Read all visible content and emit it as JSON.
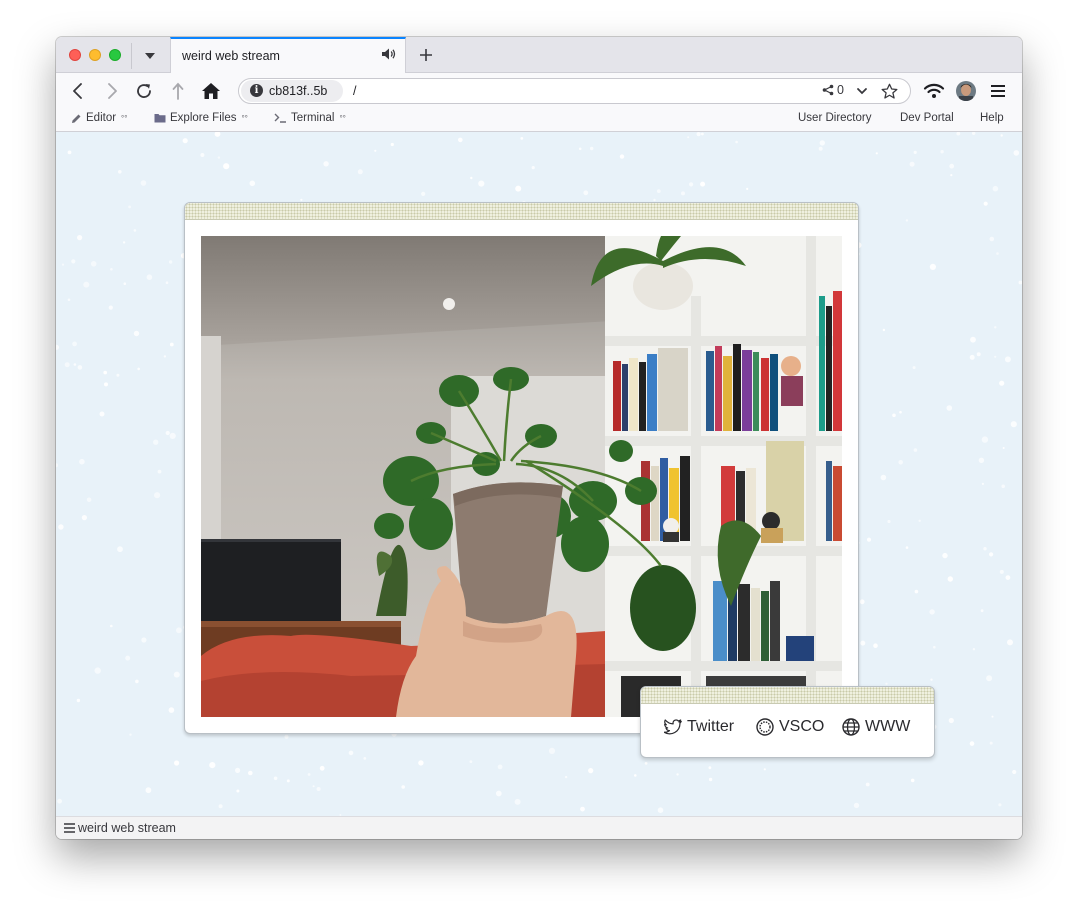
{
  "browser": {
    "tab": {
      "title": "weird web stream"
    },
    "url": {
      "host": "cb813f..5b",
      "path": "/",
      "share_count": "0"
    },
    "bookmarks_left": [
      {
        "label": "Editor",
        "suffix": "°°",
        "icon": "pencil-icon"
      },
      {
        "label": "Explore Files",
        "suffix": "°°",
        "icon": "folder-icon"
      },
      {
        "label": "Terminal",
        "suffix": "°°",
        "icon": "terminal-icon"
      }
    ],
    "bookmarks_right": [
      "User Directory",
      "Dev Portal",
      "Help"
    ],
    "status": {
      "text": "weird web stream"
    }
  },
  "page": {
    "video": {
      "description_icon": "plant-webcam-stream"
    },
    "links": [
      {
        "label": "Twitter",
        "icon": "twitter-bird-icon"
      },
      {
        "label": "VSCO",
        "icon": "vsco-ring-icon"
      },
      {
        "label": "WWW",
        "icon": "globe-icon"
      }
    ]
  },
  "colors": {
    "page_bg": "#e8f2f9",
    "tab_accent": "#0a84ff",
    "card_header": "#eff0df"
  }
}
